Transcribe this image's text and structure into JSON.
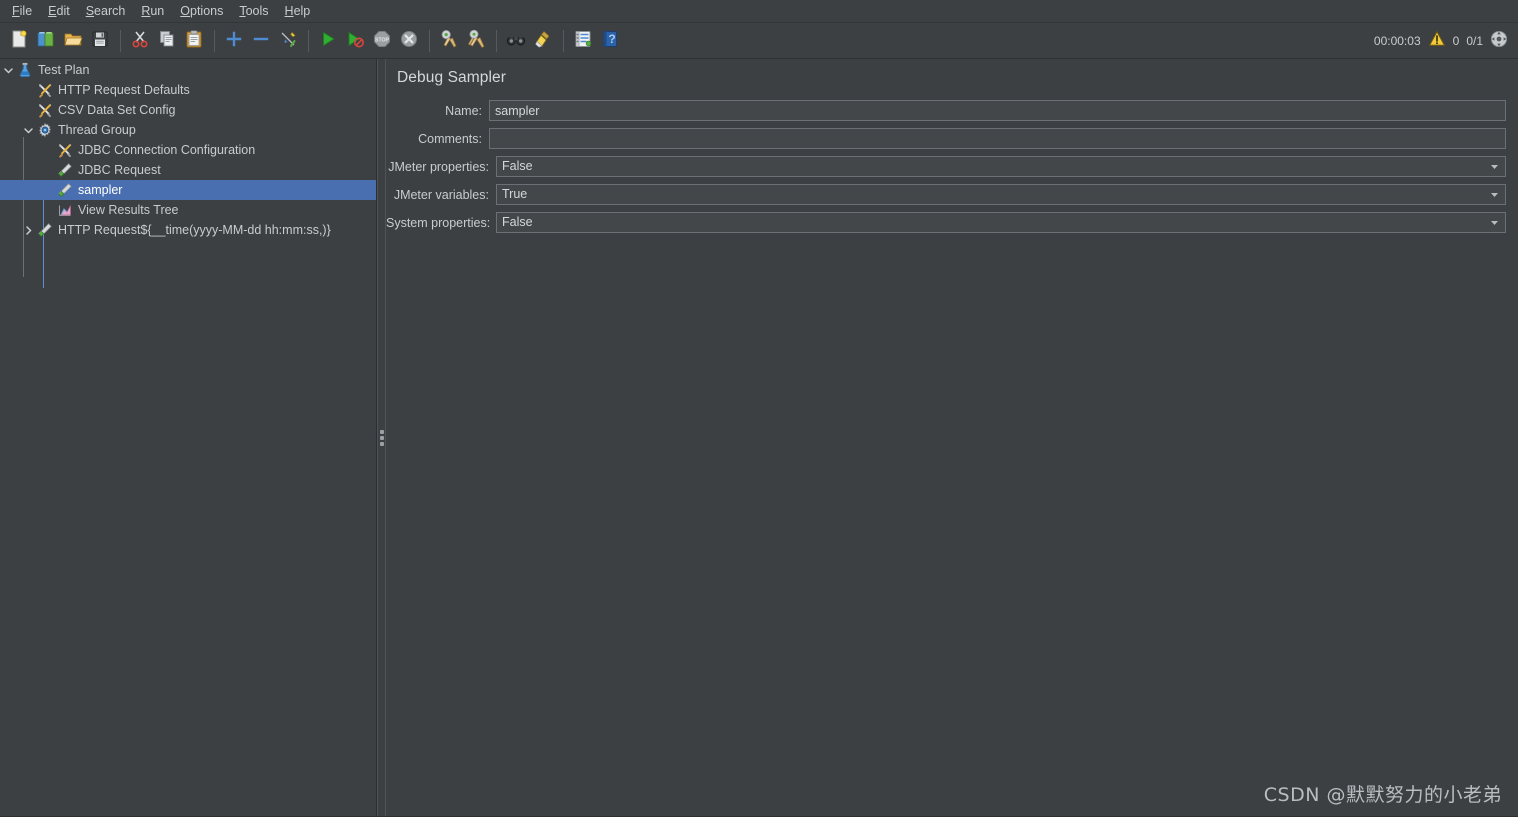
{
  "window": {
    "background_color": "#3c4043",
    "accent_color": "#4a6fb0"
  },
  "menubar": {
    "items": [
      {
        "label": "File",
        "mnemonic": "F"
      },
      {
        "label": "Edit",
        "mnemonic": "E"
      },
      {
        "label": "Search",
        "mnemonic": "S"
      },
      {
        "label": "Run",
        "mnemonic": "R"
      },
      {
        "label": "Options",
        "mnemonic": "O"
      },
      {
        "label": "Tools",
        "mnemonic": "T"
      },
      {
        "label": "Help",
        "mnemonic": "H"
      }
    ]
  },
  "toolbar": {
    "buttons": [
      {
        "name": "new-icon",
        "tooltip": "New"
      },
      {
        "name": "templates-icon",
        "tooltip": "Templates"
      },
      {
        "name": "open-icon",
        "tooltip": "Open"
      },
      {
        "name": "save-icon",
        "tooltip": "Save Test Plan"
      },
      {
        "name": "separator",
        "tooltip": ""
      },
      {
        "name": "cut-icon",
        "tooltip": "Cut"
      },
      {
        "name": "copy-icon",
        "tooltip": "Copy"
      },
      {
        "name": "paste-icon",
        "tooltip": "Paste"
      },
      {
        "name": "separator",
        "tooltip": ""
      },
      {
        "name": "expand-all-icon",
        "tooltip": "Expand All"
      },
      {
        "name": "collapse-all-icon",
        "tooltip": "Collapse All"
      },
      {
        "name": "toggle-icon",
        "tooltip": "Toggle"
      },
      {
        "name": "separator",
        "tooltip": ""
      },
      {
        "name": "start-icon",
        "tooltip": "Start"
      },
      {
        "name": "start-no-pauses-icon",
        "tooltip": "Start no pauses"
      },
      {
        "name": "stop-icon",
        "tooltip": "Stop"
      },
      {
        "name": "shutdown-icon",
        "tooltip": "Shutdown"
      },
      {
        "name": "separator",
        "tooltip": ""
      },
      {
        "name": "clear-icon",
        "tooltip": "Clear"
      },
      {
        "name": "clear-all-icon",
        "tooltip": "Clear All"
      },
      {
        "name": "separator",
        "tooltip": ""
      },
      {
        "name": "search-icon",
        "tooltip": "Search"
      },
      {
        "name": "reset-search-icon",
        "tooltip": "Reset Search"
      },
      {
        "name": "separator",
        "tooltip": ""
      },
      {
        "name": "function-helper-icon",
        "tooltip": "Function Helper Dialog"
      },
      {
        "name": "help-icon",
        "tooltip": "Help"
      }
    ],
    "status": {
      "elapsed_time": "00:00:03",
      "warning_icon": "warning-triangle-icon",
      "error_count": "0",
      "threads": "0/1",
      "remote_icon": "connect-icon"
    }
  },
  "tree": {
    "nodes": [
      {
        "label": "Test Plan",
        "icon": "flask-icon",
        "indent": 0,
        "twisty": "expanded",
        "selected": false
      },
      {
        "label": "HTTP Request Defaults",
        "icon": "config-tools-icon",
        "indent": 1,
        "twisty": "none",
        "selected": false
      },
      {
        "label": "CSV Data Set Config",
        "icon": "config-tools-icon",
        "indent": 1,
        "twisty": "none",
        "selected": false
      },
      {
        "label": "Thread Group",
        "icon": "gear-icon",
        "indent": 1,
        "twisty": "expanded",
        "selected": false
      },
      {
        "label": "JDBC Connection Configuration",
        "icon": "config-tools-icon",
        "indent": 2,
        "twisty": "none",
        "selected": false
      },
      {
        "label": "JDBC Request",
        "icon": "sampler-icon",
        "indent": 2,
        "twisty": "none",
        "selected": false
      },
      {
        "label": "sampler",
        "icon": "sampler-icon",
        "indent": 2,
        "twisty": "none",
        "selected": true
      },
      {
        "label": "View Results Tree",
        "icon": "results-tree-icon",
        "indent": 2,
        "twisty": "none",
        "selected": false
      },
      {
        "label": "HTTP Request${__time(yyyy-MM-dd hh:mm:ss,)}",
        "icon": "sampler-icon",
        "indent": 2,
        "twisty": "collapsed",
        "selected": false
      }
    ]
  },
  "detail": {
    "title": "Debug Sampler",
    "fields": [
      {
        "label": "Name:",
        "type": "text",
        "value": "sampler",
        "placeholder": ""
      },
      {
        "label": "Comments:",
        "type": "text",
        "value": "",
        "placeholder": ""
      },
      {
        "label": "JMeter properties:",
        "type": "combo",
        "value": "False",
        "options": [
          "True",
          "False"
        ]
      },
      {
        "label": "JMeter variables:",
        "type": "combo",
        "value": "True",
        "options": [
          "True",
          "False"
        ]
      },
      {
        "label": "System properties:",
        "type": "combo",
        "value": "False",
        "options": [
          "True",
          "False"
        ]
      }
    ]
  },
  "watermark": {
    "text": "CSDN @默默努力的小老弟"
  }
}
